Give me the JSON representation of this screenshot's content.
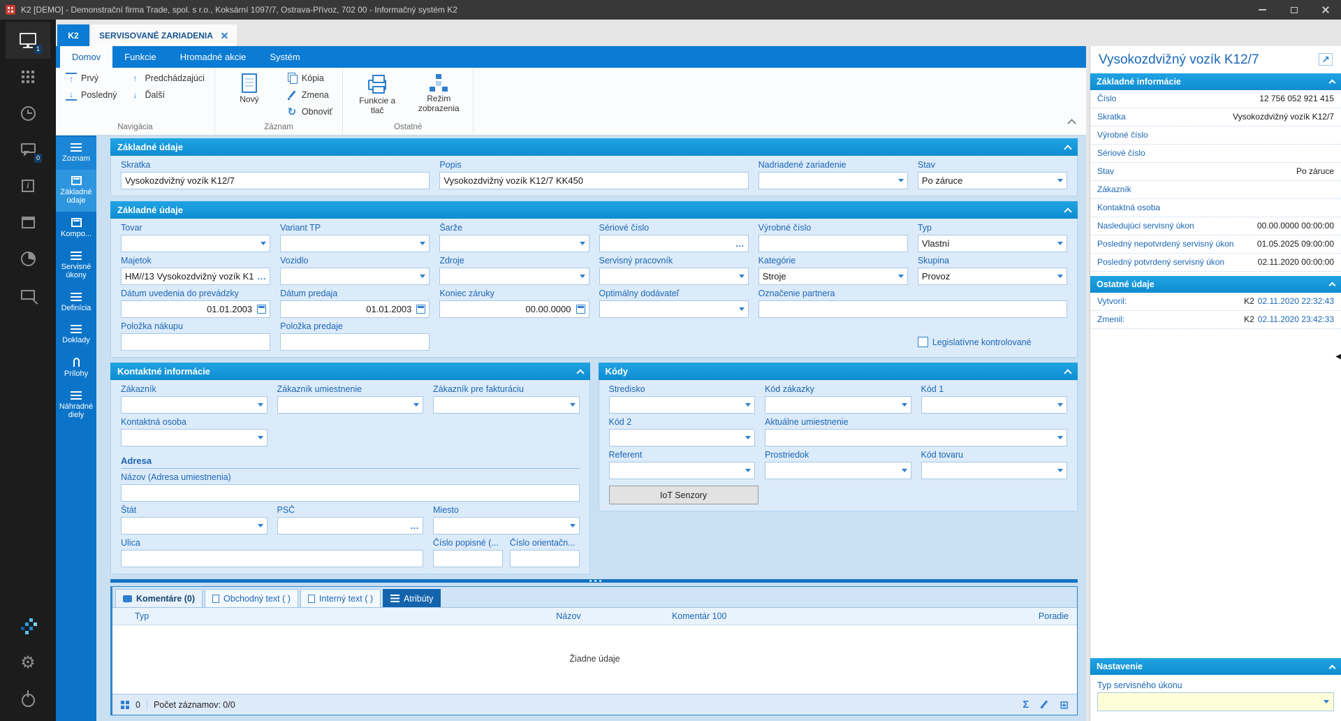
{
  "icons": {
    "sum": "Σ",
    "table": "⊞",
    "ellipsis": "…",
    "open_external": "↗",
    "collapse_left": "◀"
  },
  "titlebar": {
    "title": "K2 [DEMO] - Demonstrační firma Trade, spol. s r.o., Koksární 1097/7, Ostrava-Přívoz, 702 00 - Informačný systém K2"
  },
  "rail": {
    "items": [
      {
        "name": "desktop",
        "badge": "1",
        "active": true
      },
      {
        "name": "apps"
      },
      {
        "name": "history"
      },
      {
        "name": "messages",
        "badge": "0"
      },
      {
        "name": "info"
      },
      {
        "name": "calendar"
      },
      {
        "name": "reports"
      },
      {
        "name": "devices"
      }
    ],
    "bottom": [
      {
        "name": "logo"
      },
      {
        "name": "settings"
      },
      {
        "name": "power"
      }
    ]
  },
  "doc_tabs": [
    {
      "label": "K2",
      "style": "home"
    },
    {
      "label": "SERVISOVANÉ ZARIADENIA",
      "style": "active",
      "closable": true
    }
  ],
  "ribbon": {
    "tabs": [
      {
        "label": "Domov",
        "active": true
      },
      {
        "label": "Funkcie"
      },
      {
        "label": "Hromadné akcie"
      },
      {
        "label": "Systém"
      }
    ],
    "groups": [
      {
        "label": "Navigácia",
        "cols": [
          [
            {
              "label": "Prvý",
              "icon": "first"
            },
            {
              "label": "Posledný",
              "icon": "last"
            }
          ],
          [
            {
              "label": "Predchádzajúci",
              "icon": "prev"
            },
            {
              "label": "Ďalší",
              "icon": "next"
            }
          ]
        ]
      },
      {
        "label": "Záznam",
        "big": [
          {
            "label": "Nový",
            "icon": "newdoc"
          }
        ],
        "cols": [
          [
            {
              "label": "Kópia",
              "icon": "copy"
            },
            {
              "label": "Zmena",
              "icon": "edit"
            },
            {
              "label": "Obnoviť",
              "icon": "refresh"
            }
          ]
        ]
      },
      {
        "label": "Ostatné",
        "big": [
          {
            "label": "Funkcie a tlač",
            "icon": "print"
          },
          {
            "label": "Režim zobrazenia",
            "icon": "orgchart"
          }
        ]
      }
    ]
  },
  "side_nav": [
    {
      "label": "Zoznam",
      "icon": "lines",
      "first": true
    },
    {
      "label": "Základné údaje",
      "icon": "form",
      "active": true
    },
    {
      "label": "Kompo...",
      "icon": "form"
    },
    {
      "label": "Servisné úkony",
      "icon": "lines"
    },
    {
      "label": "Definícia",
      "icon": "lines"
    },
    {
      "label": "Doklady",
      "icon": "lines"
    },
    {
      "label": "Prílohy",
      "icon": "clip"
    },
    {
      "label": "Náhradné diely",
      "icon": "lines"
    }
  ],
  "form": {
    "sections": [
      {
        "title": "Základné údaje",
        "cols": 6,
        "fields": [
          {
            "label": "Skratka",
            "value": "Vysokozdvižný vozík K12/7",
            "type": "text",
            "span": 2
          },
          {
            "label": "Popis",
            "value": "Vysokozdvižný vozík K12/7 KK450",
            "type": "text",
            "span": 2
          },
          {
            "label": "Nadriadené zariadenie",
            "value": "",
            "type": "dd"
          },
          {
            "label": "Stav",
            "value": "Po záruce",
            "type": "dd"
          }
        ]
      },
      {
        "title": "Základné údaje",
        "cols": 6,
        "fields": [
          {
            "label": "Tovar",
            "value": "",
            "type": "dd"
          },
          {
            "label": "Variant TP",
            "value": "",
            "type": "dd"
          },
          {
            "label": "Šarže",
            "value": "",
            "type": "dd"
          },
          {
            "label": "Sériové číslo",
            "value": "",
            "type": "ellipsis"
          },
          {
            "label": "Výrobné číslo",
            "value": "",
            "type": "text"
          },
          {
            "label": "Typ",
            "value": "Vlastní",
            "type": "dd"
          },
          {
            "label": "Majetok",
            "value": "HM//13 Vysokozdvižný vozík K1...",
            "type": "ellipsis"
          },
          {
            "label": "Vozidlo",
            "value": "",
            "type": "dd"
          },
          {
            "label": "Zdroje",
            "value": "",
            "type": "dd"
          },
          {
            "label": "Servisný pracovník",
            "value": "",
            "type": "dd"
          },
          {
            "label": "Kategórie",
            "value": "Stroje",
            "type": "dd"
          },
          {
            "label": "Skupina",
            "value": "Provoz",
            "type": "dd"
          },
          {
            "label": "Dátum uvedenia do prevádzky",
            "value": "01.01.2003",
            "type": "date"
          },
          {
            "label": "Dátum predaja",
            "value": "01.01.2003",
            "type": "date"
          },
          {
            "label": "Koniec záruky",
            "value": "00.00.0000",
            "type": "date"
          },
          {
            "label": "Optimálny dodávateľ",
            "value": "",
            "type": "dd"
          },
          {
            "label": "Označenie partnera",
            "value": "",
            "type": "text",
            "span": 2
          },
          {
            "label": "Položka nákupu",
            "value": "",
            "type": "text"
          },
          {
            "label": "Položka predaje",
            "value": "",
            "type": "text"
          },
          {
            "type": "spacer",
            "span": 3
          },
          {
            "type": "checkbox",
            "label": "Legislatívne kontrolované",
            "checked": false
          }
        ]
      },
      {
        "title": "Kontaktné informácie",
        "cols": 3,
        "half": true,
        "fields": [
          {
            "label": "Zákazník",
            "value": "",
            "type": "dd"
          },
          {
            "label": "Zákazník umiestnenie",
            "value": "",
            "type": "dd"
          },
          {
            "label": "Zákazník pre fakturáciu",
            "value": "",
            "type": "dd"
          },
          {
            "label": "Kontaktná osoba",
            "value": "",
            "type": "dd"
          },
          {
            "type": "spacer",
            "span": 2
          },
          {
            "type": "subheading",
            "label": "Adresa",
            "span": 3
          },
          {
            "label": "Názov (Adresa umiestnenia)",
            "value": "",
            "type": "text",
            "span": 3
          },
          {
            "label": "Štát",
            "value": "",
            "type": "dd"
          },
          {
            "label": "PSČ",
            "value": "",
            "type": "ellipsis"
          },
          {
            "label": "Miesto",
            "value": "",
            "type": "dd"
          },
          {
            "label": "Ulica",
            "value": "",
            "type": "text",
            "span": 2
          },
          {
            "type": "pair",
            "fields": [
              {
                "label": "Číslo popisné (...",
                "value": "",
                "type": "text"
              },
              {
                "label": "Číslo orientačn...",
                "value": "",
                "type": "text"
              }
            ]
          }
        ]
      },
      {
        "title": "Kódy",
        "cols": 3,
        "half": true,
        "button": "IoT Senzory",
        "fields": [
          {
            "label": "Stredisko",
            "value": "",
            "type": "dd"
          },
          {
            "label": "Kód zákazky",
            "value": "",
            "type": "dd"
          },
          {
            "label": "Kód 1",
            "value": "",
            "type": "dd"
          },
          {
            "label": "Kód 2",
            "value": "",
            "type": "dd"
          },
          {
            "label": "Aktuálne umiestnenie",
            "value": "",
            "type": "dd",
            "span": 2
          },
          {
            "label": "Referent",
            "value": "",
            "type": "dd"
          },
          {
            "label": "Prostriedok",
            "value": "",
            "type": "dd"
          },
          {
            "label": "Kód tovaru",
            "value": "",
            "type": "dd"
          }
        ]
      }
    ]
  },
  "bottom_panel": {
    "tabs": [
      {
        "label": "Komentáre (0)",
        "icon": "comment",
        "style": "first"
      },
      {
        "label": "Obchodný text ( )",
        "icon": "doc"
      },
      {
        "label": "Interný text ( )",
        "icon": "doc"
      },
      {
        "label": "Atribúty",
        "icon": "list",
        "style": "selected"
      }
    ],
    "columns": [
      "Typ",
      "Názov",
      "Komentár 100",
      "Poradie"
    ],
    "empty_text": "Žiadne údaje",
    "footer": {
      "count": "0",
      "records": "Počet záznamov: 0/0"
    }
  },
  "right_panel": {
    "title": "Vysokozdvižný vozík K12/7",
    "info_title": "Základné informácie",
    "info_rows": [
      {
        "label": "Číslo",
        "value": "12 756 052 921 415"
      },
      {
        "label": "Skratka",
        "value": "Vysokozdvižný vozík K12/7"
      },
      {
        "label": "Výrobné číslo",
        "value": ""
      },
      {
        "label": "Sériové číslo",
        "value": ""
      },
      {
        "label": "Stav",
        "value": "Po záruce"
      },
      {
        "label": "Zákazník",
        "value": ""
      },
      {
        "label": "Kontaktná osoba",
        "value": ""
      },
      {
        "label": "Nasledujúci servisný úkon",
        "value": "00.00.0000 00:00:00"
      },
      {
        "label": "Posledný nepotvrdený servisný úkon",
        "value": "01.05.2025 09:00:00"
      },
      {
        "label": "Posledný potvrdený servisný úkon",
        "value": "02.11.2020 00:00:00"
      }
    ],
    "other_title": "Ostatné údaje",
    "audit_rows": [
      {
        "label": "Vytvoril:",
        "value": "K2",
        "date": "02.11.2020 22:32:43"
      },
      {
        "label": "Zmenil:",
        "value": "K2",
        "date": "02.11.2020 23:42:33"
      }
    ],
    "settings_title": "Nastavenie",
    "setting_field": {
      "label": "Typ servisného úkonu",
      "value": ""
    }
  }
}
